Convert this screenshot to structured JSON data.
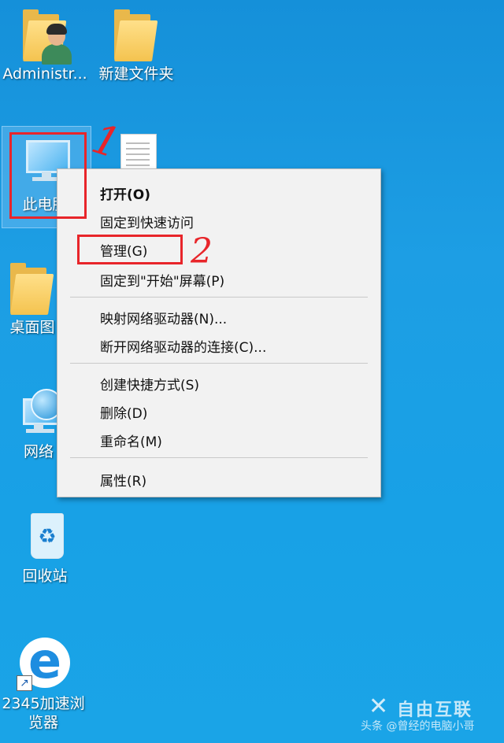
{
  "desktop": {
    "icons": [
      {
        "label": "Administr..."
      },
      {
        "label": "新建文件夹"
      },
      {
        "label": "此电脑"
      },
      {
        "label": "桌面图"
      },
      {
        "label": "网络"
      },
      {
        "label": "回收站"
      },
      {
        "label": "2345加速浏"
      },
      {
        "label": "览器"
      }
    ]
  },
  "context_menu": {
    "items": [
      {
        "label": "打开(O)"
      },
      {
        "label": "固定到快速访问"
      },
      {
        "label": "管理(G)"
      },
      {
        "label": "固定到\"开始\"屏幕(P)"
      },
      {
        "label": "映射网络驱动器(N)..."
      },
      {
        "label": "断开网络驱动器的连接(C)..."
      },
      {
        "label": "创建快捷方式(S)"
      },
      {
        "label": "删除(D)"
      },
      {
        "label": "重命名(M)"
      },
      {
        "label": "属性(R)"
      }
    ]
  },
  "annotations": {
    "step1": "1",
    "step2": "2"
  },
  "watermark": {
    "logo_text": "自由互联",
    "credit": "头条 @曾经的电脑小哥"
  },
  "colors": {
    "desktop_bg": "#1a9be3",
    "menu_bg": "#f2f2f2",
    "annotation_red": "#e8252a"
  }
}
